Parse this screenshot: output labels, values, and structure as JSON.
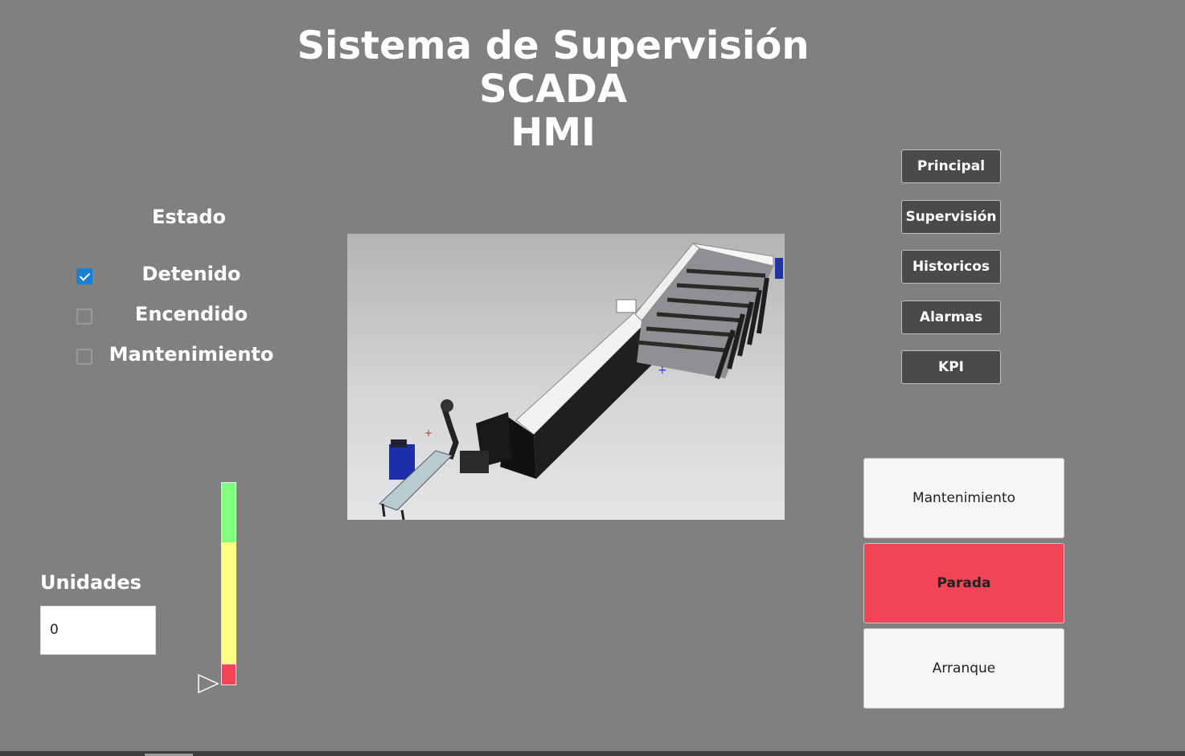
{
  "header": {
    "title_line1": "Sistema de Supervisión SCADA",
    "title_line2": "HMI"
  },
  "estado": {
    "title": "Estado",
    "states": [
      {
        "label": "Detenido",
        "checked": true
      },
      {
        "label": "Encendido",
        "checked": false
      },
      {
        "label": "Mantenimiento",
        "checked": false
      }
    ]
  },
  "nav": {
    "items": [
      "Principal",
      "Supervisión",
      "Historicos",
      "Alarmas",
      "KPI"
    ]
  },
  "controls": {
    "mantenimiento_label": "Mantenimiento",
    "parada_label": "Parada",
    "arranque_label": "Arranque"
  },
  "units": {
    "label": "Unidades",
    "value": "0"
  },
  "gauge": {
    "level": 0
  },
  "colors": {
    "background": "#808080",
    "nav_button": "#4a4a4a",
    "parada": "#f24555",
    "gauge_green": "#80ff80",
    "gauge_yellow": "#ffff80",
    "gauge_red": "#f24555",
    "checkbox_checked": "#1a7fd1"
  }
}
